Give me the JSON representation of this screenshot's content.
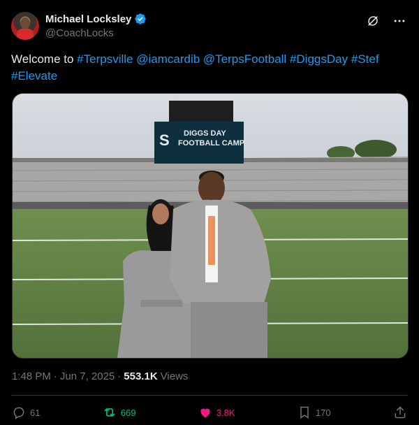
{
  "author": {
    "display_name": "Michael Locksley",
    "handle": "@CoachLocks"
  },
  "tweet": {
    "text_prefix": "Welcome to ",
    "hashtags_line1": [
      "#Terpsville",
      "@iamcardib",
      "@TerpsFootball",
      "#DiggsDay",
      "#Stef"
    ],
    "hashtag_line2": "#Elevate"
  },
  "media": {
    "scoreboard_line1": "DIGGS DAY",
    "scoreboard_line2": "FOOTBALL CAMP"
  },
  "meta": {
    "time": "1:48 PM",
    "separator": "·",
    "date": "Jun 7, 2025",
    "separator2": "·",
    "views_count": "553.1K",
    "views_label": "Views"
  },
  "actions": {
    "replies": "61",
    "retweets": "669",
    "likes": "3.8K",
    "bookmarks": "170"
  },
  "colors": {
    "link": "#1d9bf0",
    "retweet": "#00ba7c",
    "like": "#f91880",
    "muted": "#71767b"
  }
}
